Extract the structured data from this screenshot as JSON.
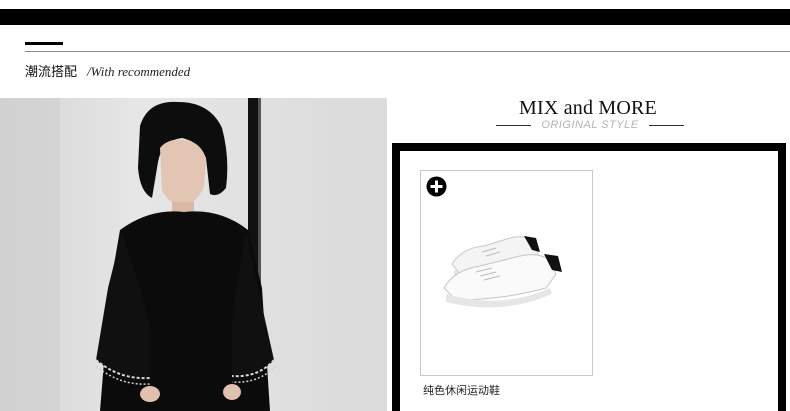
{
  "section": {
    "title_cn": "潮流搭配",
    "title_en": "/With recommended"
  },
  "mix": {
    "title": "MIX and MORE",
    "subtitle": "ORIGINAL STYLE"
  },
  "product": {
    "name": "纯色休闲运动鞋",
    "add_icon": "plus-circle-icon",
    "image": "white-sneakers-image"
  },
  "colors": {
    "frame": "#000000",
    "subtitle_gray": "#b3b3b3"
  }
}
